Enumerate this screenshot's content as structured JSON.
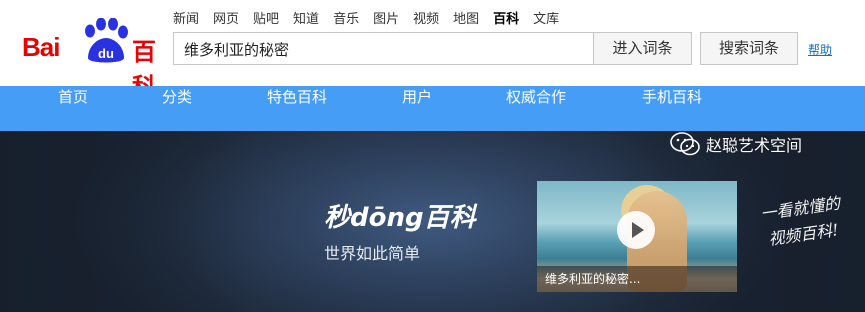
{
  "logo": {
    "bai": "Bai",
    "du": "du",
    "baike": "百科"
  },
  "top_nav": {
    "links": [
      "新闻",
      "网页",
      "贴吧",
      "知道",
      "音乐",
      "图片",
      "视频",
      "地图",
      "百科",
      "文库"
    ],
    "active": "百科"
  },
  "search": {
    "value": "维多利亚的秘密",
    "enter_button": "进入词条",
    "search_button": "搜索词条",
    "help_link": "帮助"
  },
  "main_nav": {
    "items": [
      "首页",
      "分类",
      "特色百科",
      "用户",
      "权威合作",
      "手机百科"
    ]
  },
  "banner": {
    "brand": "秒dōng百科",
    "tagline": "世界如此简单",
    "video_caption": "维多利亚的秘密...",
    "handwriting_line1": "一看就懂的",
    "handwriting_line2": "视频百科!"
  },
  "watermark": {
    "text": "赵聪艺术空间",
    "icon": "wechat-icon"
  },
  "colors": {
    "brand_red": "#e10602",
    "brand_blue": "#2932e1",
    "nav_blue": "#459df5",
    "link_blue": "#136ec2"
  }
}
